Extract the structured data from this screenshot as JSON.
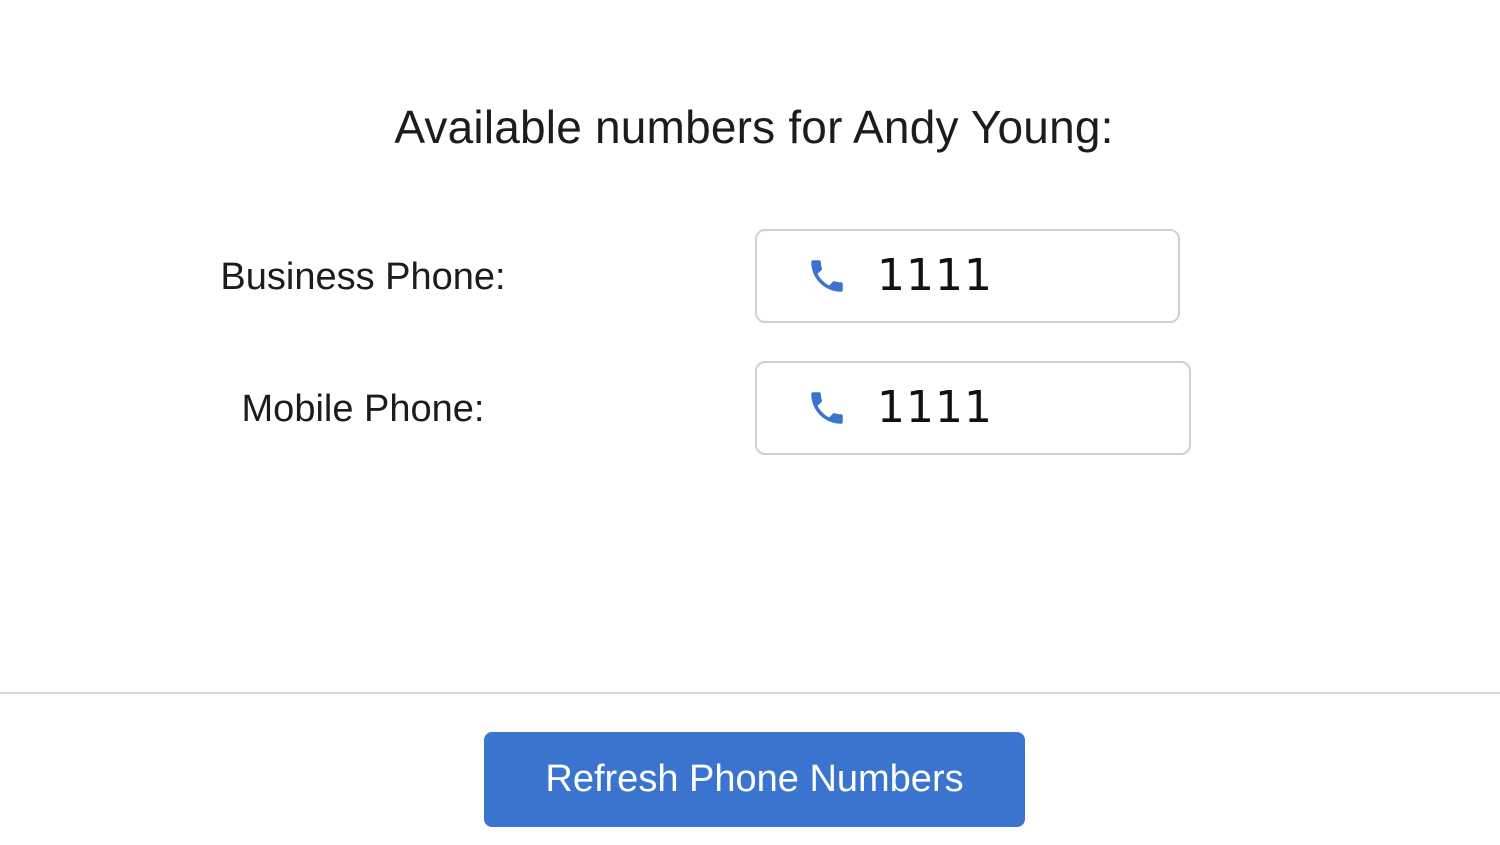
{
  "header": {
    "title": "Available numbers for Andy Young:"
  },
  "phones": [
    {
      "label": "Business Phone:",
      "number": "1111",
      "icon": "phone-icon"
    },
    {
      "label": "Mobile Phone:",
      "number": "1111",
      "icon": "phone-icon"
    }
  ],
  "footer": {
    "refresh_label": "Refresh Phone Numbers"
  },
  "colors": {
    "accent": "#3b74cf",
    "icon": "#3b74cf",
    "border": "#d0d0d0",
    "divider": "#d6d6d6"
  }
}
